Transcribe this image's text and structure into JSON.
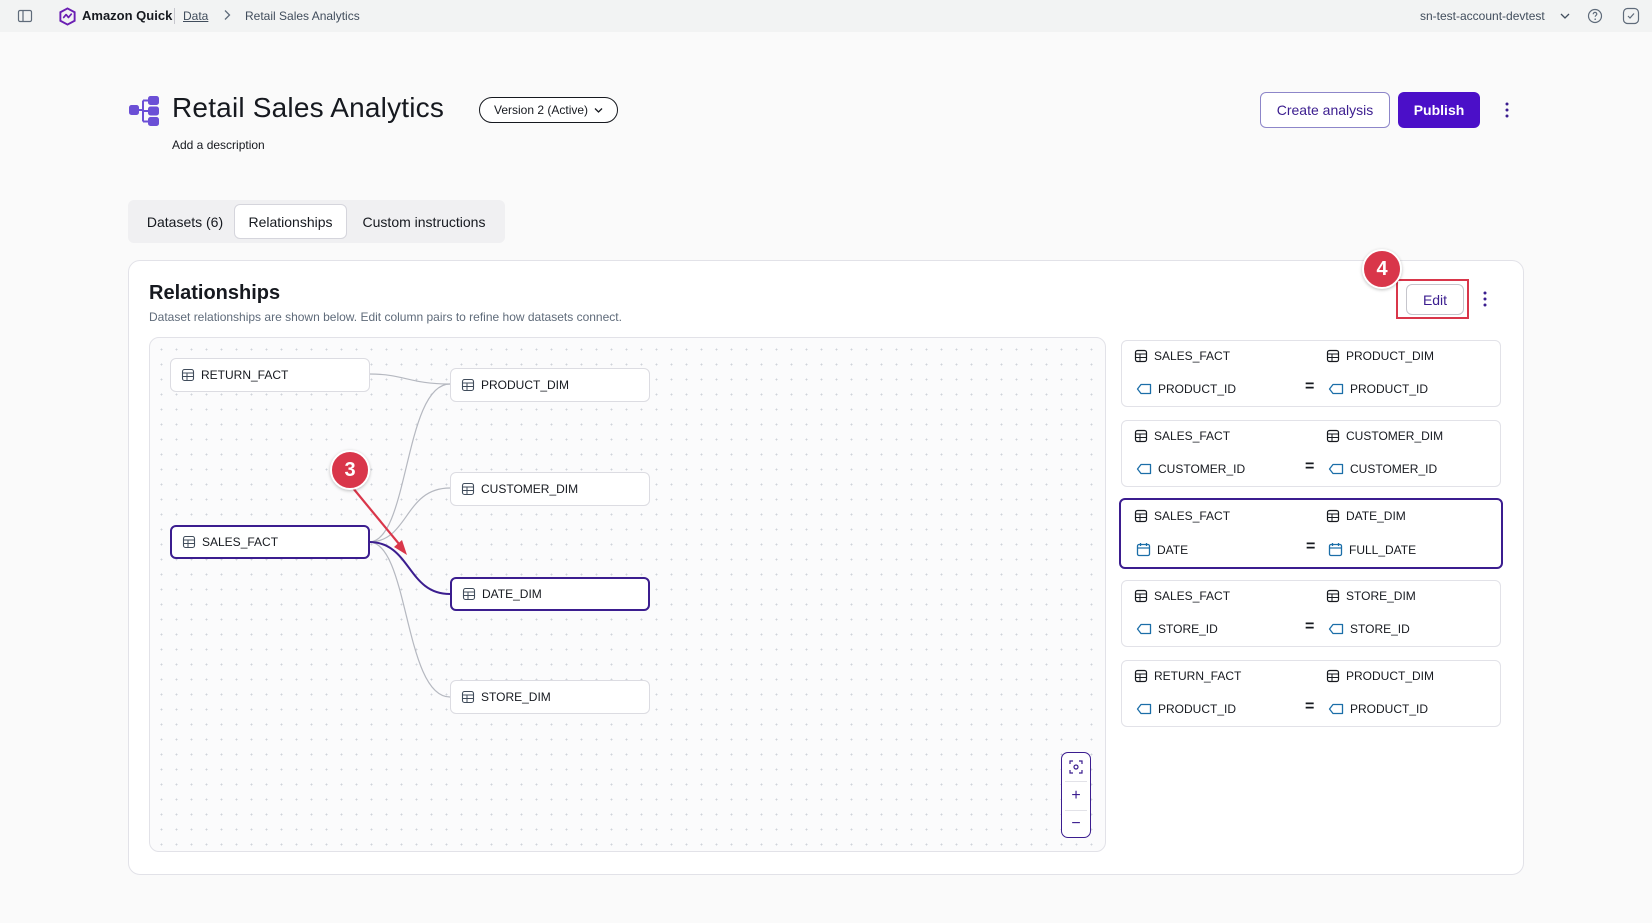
{
  "topbar": {
    "app_name": "Amazon Quick",
    "breadcrumb_parent": "Data",
    "breadcrumb_current": "Retail Sales Analytics",
    "account": "sn-test-account-devtest"
  },
  "header": {
    "title": "Retail Sales Analytics",
    "description_prompt": "Add a description",
    "version_label": "Version 2 (Active)",
    "create_analysis_label": "Create analysis",
    "publish_label": "Publish"
  },
  "tabs": [
    {
      "label": "Datasets (6)",
      "active": false
    },
    {
      "label": "Relationships",
      "active": true
    },
    {
      "label": "Custom instructions",
      "active": false
    }
  ],
  "panel": {
    "title": "Relationships",
    "subtitle": "Dataset relationships are shown below. Edit column pairs to refine how datasets connect.",
    "edit_label": "Edit"
  },
  "annotations": {
    "step_3": "3",
    "step_4": "4"
  },
  "graph": {
    "nodes": [
      {
        "id": "return_fact",
        "label": "RETURN_FACT",
        "selected": false
      },
      {
        "id": "product_dim",
        "label": "PRODUCT_DIM",
        "selected": false
      },
      {
        "id": "customer_dim",
        "label": "CUSTOMER_DIM",
        "selected": false
      },
      {
        "id": "sales_fact",
        "label": "SALES_FACT",
        "selected": true
      },
      {
        "id": "date_dim",
        "label": "DATE_DIM",
        "selected": true
      },
      {
        "id": "store_dim",
        "label": "STORE_DIM",
        "selected": false
      }
    ]
  },
  "relationships": [
    {
      "left_table": "SALES_FACT",
      "right_table": "PRODUCT_DIM",
      "left_column": "PRODUCT_ID",
      "right_column": "PRODUCT_ID",
      "operator": "=",
      "column_type": "tag-icon",
      "selected": false
    },
    {
      "left_table": "SALES_FACT",
      "right_table": "CUSTOMER_DIM",
      "left_column": "CUSTOMER_ID",
      "right_column": "CUSTOMER_ID",
      "operator": "=",
      "column_type": "tag-icon",
      "selected": false
    },
    {
      "left_table": "SALES_FACT",
      "right_table": "DATE_DIM",
      "left_column": "DATE",
      "right_column": "FULL_DATE",
      "operator": "=",
      "column_type": "calendar-icon",
      "selected": true
    },
    {
      "left_table": "SALES_FACT",
      "right_table": "STORE_DIM",
      "left_column": "STORE_ID",
      "right_column": "STORE_ID",
      "operator": "=",
      "column_type": "tag-icon",
      "selected": false
    },
    {
      "left_table": "RETURN_FACT",
      "right_table": "PRODUCT_DIM",
      "left_column": "PRODUCT_ID",
      "right_column": "PRODUCT_ID",
      "operator": "=",
      "column_type": "tag-icon",
      "selected": false
    }
  ],
  "zoom_controls": {
    "plus": "+",
    "minus": "−"
  },
  "colors": {
    "accent": "#3b1d8f",
    "primary_button": "#4b0fc8",
    "annotation_red": "#d9364a"
  }
}
